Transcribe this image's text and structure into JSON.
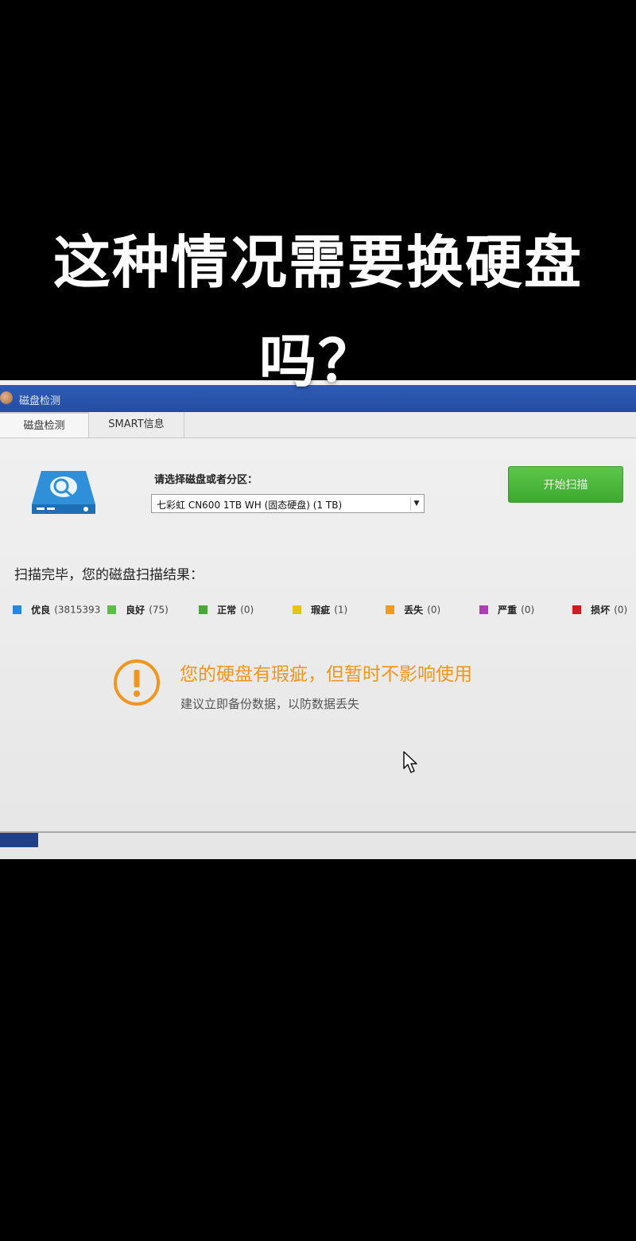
{
  "caption": {
    "line1": "这种情况需要换硬盘",
    "line2": "吗？"
  },
  "window": {
    "title": "磁盘检测"
  },
  "tabs": [
    {
      "label": "磁盘检测",
      "active": true
    },
    {
      "label": "SMART信息",
      "active": false
    }
  ],
  "disk_select": {
    "label": "请选择磁盘或者分区：",
    "value": "七彩虹  CN600 1TB WH (固态硬盘)  (1 TB)"
  },
  "scan_button": {
    "label": "开始扫描"
  },
  "results": {
    "heading": "扫描完毕，您的磁盘扫描结果：",
    "legend": [
      {
        "name": "优良",
        "count": "(3815393",
        "color": "#2a86d8"
      },
      {
        "name": "良好",
        "count": "(75)",
        "color": "#5bbf45"
      },
      {
        "name": "正常",
        "count": "(0)",
        "color": "#4aa83a"
      },
      {
        "name": "瑕疵",
        "count": "(1)",
        "color": "#e4c416"
      },
      {
        "name": "丢失",
        "count": "(0)",
        "color": "#f09a1f"
      },
      {
        "name": "严重",
        "count": "(0)",
        "color": "#b03cb8"
      },
      {
        "name": "损坏",
        "count": "(0)",
        "color": "#c81e24"
      }
    ]
  },
  "warning": {
    "title": "您的硬盘有瑕疵，但暂时不影响使用",
    "subtitle": "建议立即备份数据，以防数据丢失",
    "accent_color": "#f0961c",
    "icon": "warning-icon"
  }
}
